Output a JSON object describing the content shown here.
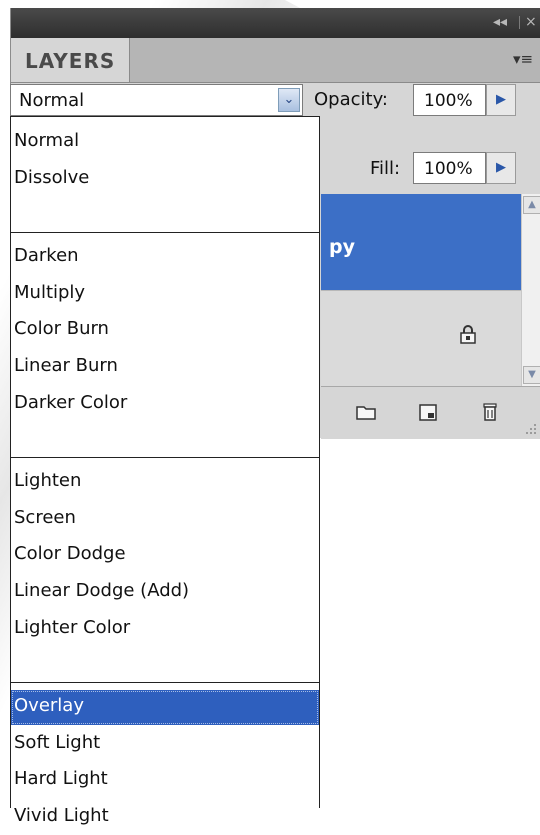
{
  "panel": {
    "title_controls": {
      "collapse": "◂◂",
      "close": "×"
    },
    "tab_label": "LAYERS",
    "menu_icon": "≡"
  },
  "blend_mode": {
    "current": "Normal"
  },
  "opacity": {
    "label": "Opacity:",
    "value": "100%"
  },
  "fill": {
    "label": "Fill:",
    "value": "100%"
  },
  "layers": {
    "selected_name_fragment": "py"
  },
  "dropdown_groups": [
    [
      "Normal",
      "Dissolve"
    ],
    [
      "Darken",
      "Multiply",
      "Color Burn",
      "Linear Burn",
      "Darker Color"
    ],
    [
      "Lighten",
      "Screen",
      "Color Dodge",
      "Linear Dodge (Add)",
      "Lighter Color"
    ],
    [
      "Overlay",
      "Soft Light",
      "Hard Light",
      "Vivid Light"
    ]
  ],
  "highlighted_item": "Overlay",
  "colors": {
    "selected_layer": "#3c6fc6",
    "highlight": "#2e5fbe",
    "panel_bg": "#d6d6d6",
    "titlebar": "#3a3a3a"
  },
  "icons": [
    "chevron-down-icon",
    "play-right-icon",
    "lock-icon",
    "folder-icon",
    "new-layer-icon",
    "trash-icon",
    "resize-grip-icon",
    "scroll-up-icon",
    "scroll-down-icon",
    "panel-menu-icon"
  ]
}
